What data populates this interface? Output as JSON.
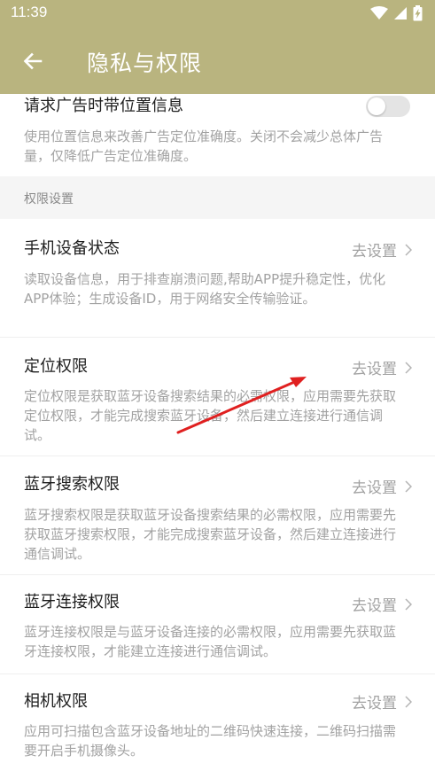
{
  "status_bar": {
    "time": "11:39",
    "icons": [
      "wifi-icon",
      "signal-icon",
      "battery-charging-icon"
    ]
  },
  "app_bar": {
    "back_icon": "arrow-left-icon",
    "title": "隐私与权限"
  },
  "ad_location": {
    "title": "请求广告时带位置信息",
    "description": "使用位置信息来改善广告定位准确度。关闭不会减少总体广告量，仅降低广告定位准确度。",
    "toggle_on": false
  },
  "section": {
    "label": "权限设置"
  },
  "permissions": [
    {
      "title": "手机设备状态",
      "action": "去设置",
      "description": "读取设备信息，用于排查崩溃问题,帮助APP提升稳定性，优化APP体验；生成设备ID，用于网络安全传输验证。"
    },
    {
      "title": "定位权限",
      "action": "去设置",
      "description": "定位权限是获取蓝牙设备搜索结果的必需权限，应用需要先获取定位权限，才能完成搜索蓝牙设备，然后建立连接进行通信调试。"
    },
    {
      "title": "蓝牙搜索权限",
      "action": "去设置",
      "description": "蓝牙搜索权限是获取蓝牙设备搜索结果的必需权限，应用需要先获取蓝牙搜索权限，才能完成搜索蓝牙设备，然后建立连接进行通信调试。"
    },
    {
      "title": "蓝牙连接权限",
      "action": "去设置",
      "description": "蓝牙连接权限是与蓝牙设备连接的必需权限，应用需要先获取蓝牙连接权限，才能建立连接进行通信调试。"
    },
    {
      "title": "相机权限",
      "action": "去设置",
      "description": "应用可扫描包含蓝牙设备地址的二维码快速连接，二维码扫描需要开启手机摄像头。"
    }
  ],
  "colors": {
    "header": "#b9b47f",
    "annotation_arrow": "#e02020"
  }
}
